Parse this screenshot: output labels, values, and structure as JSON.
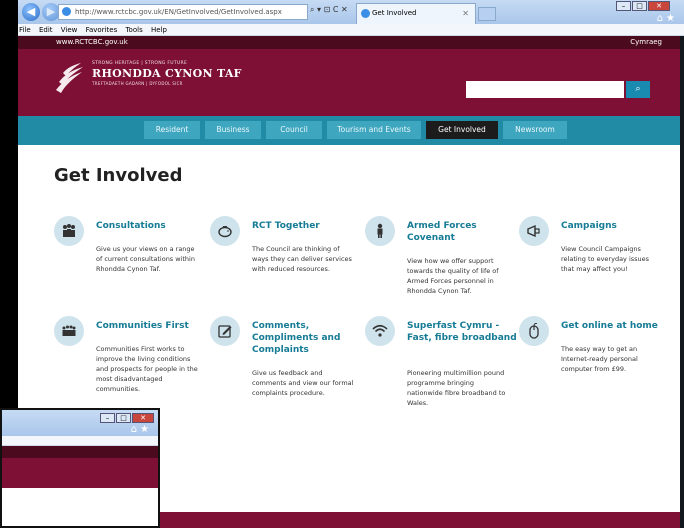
{
  "browser": {
    "address": "http://www.rctcbc.gov.uk/EN/GetInvolved/GetInvolved.aspx",
    "tools": "⌕ ▾ ⊡ C ✕",
    "tab_title": "Get Involved",
    "menu": [
      "File",
      "Edit",
      "View",
      "Favorites",
      "Tools",
      "Help"
    ]
  },
  "site": {
    "url_text": "www.RCTCBC.gov.uk",
    "language_link": "Cymraeg",
    "logo": {
      "tagline": "STRONG HERITAGE | STRONG FUTURE",
      "name": "RHONDDA CYNON TAF",
      "subline": "TREFTADAETH GADARN | DYFODOL SICR"
    },
    "search": {
      "placeholder": "",
      "button": "⌕"
    },
    "nav": [
      "Resident",
      "Business",
      "Council",
      "Tourism and Events",
      "Get Involved",
      "Newsroom"
    ],
    "active_nav": "Get Involved"
  },
  "page": {
    "title": "Get Involved",
    "cards": [
      {
        "title": "Consultations",
        "icon": "people-group-icon",
        "desc": "Give us your views on a range of current consultations within Rhondda Cynon Taf."
      },
      {
        "title": "RCT Together",
        "icon": "piggy-bank-icon",
        "desc": "The Council are thinking of ways they can deliver services with reduced resources."
      },
      {
        "title": "Armed Forces Covenant",
        "icon": "soldier-icon",
        "desc": "View how we offer support towards the quality of life of Armed Forces personnel in Rhondda Cynon Taf."
      },
      {
        "title": "Campaigns",
        "icon": "megaphone-icon",
        "desc": "View Council Campaigns relating to everyday issues that may affect you!"
      },
      {
        "title": "Communities First",
        "icon": "crowd-icon",
        "desc": "Communities First works to improve the living conditions and prospects for people in the most disadvantaged communities."
      },
      {
        "title": "Comments, Compliments and Complaints",
        "icon": "edit-icon",
        "desc": "Give us feedback and comments and view our formal complaints procedure."
      },
      {
        "title": "Superfast Cymru - Fast, fibre broadband",
        "icon": "wifi-icon",
        "desc": "Pioneering multimillion pound programme bringing nationwide fibre broadband to Wales."
      },
      {
        "title": "Get online at home",
        "icon": "mouse-icon",
        "desc": "The easy way to get an Internet-ready personal computer from £99."
      }
    ]
  },
  "colors": {
    "maroon": "#7d1034",
    "dark_maroon": "#4c0a1f",
    "teal": "#218ba5",
    "title_teal": "#167b95"
  }
}
